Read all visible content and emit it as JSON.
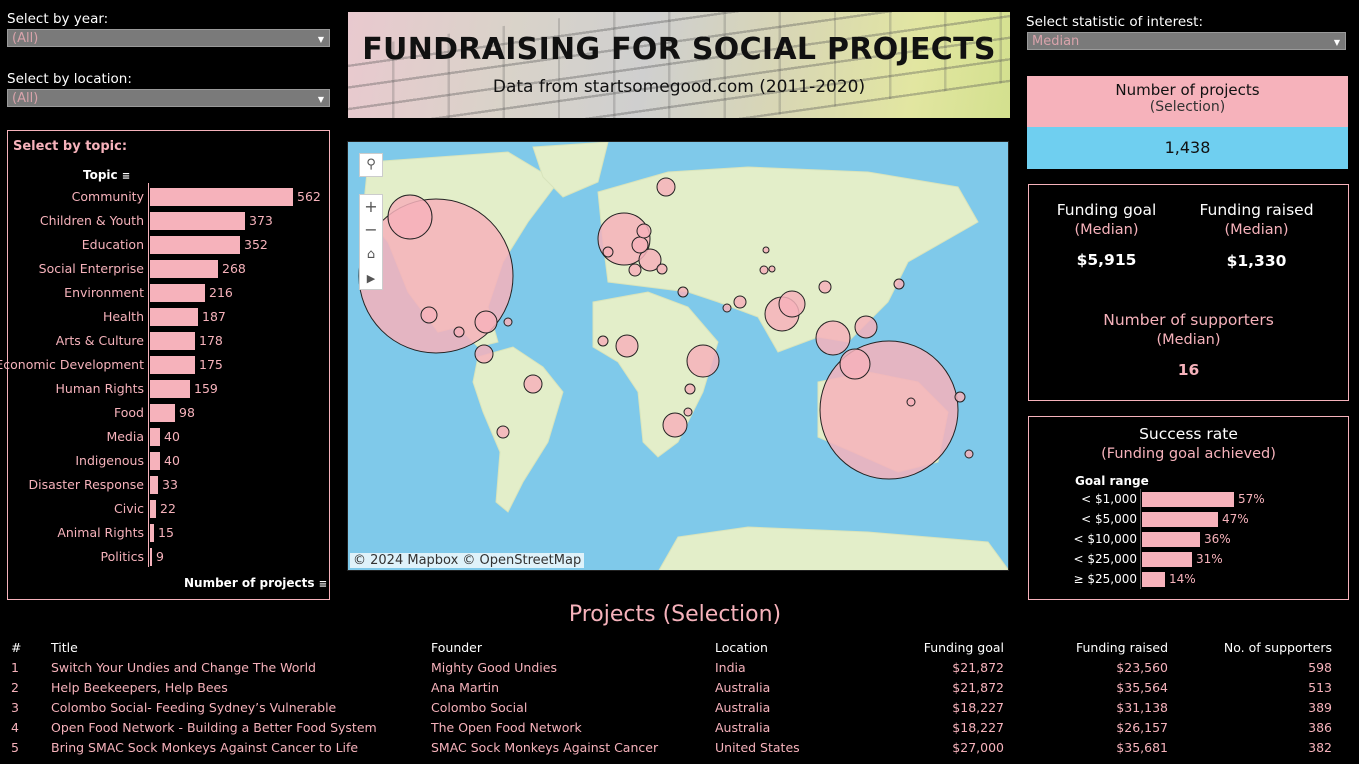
{
  "filters": {
    "year_label": "Select by year:",
    "year_value": "(All)",
    "location_label": "Select by location:",
    "location_value": "(All)",
    "statistic_label": "Select statistic of interest:",
    "statistic_value": "Median"
  },
  "banner": {
    "title": "FUNDRAISING FOR SOCIAL PROJECTS",
    "subtitle": "Data from startsomegood.com (2011-2020)"
  },
  "topic_panel": {
    "title": "Select by topic:",
    "header": "Topic",
    "axis_label": "Number of projects"
  },
  "chart_data": [
    {
      "type": "bar",
      "orientation": "horizontal",
      "categories": [
        "Community",
        "Children & Youth",
        "Education",
        "Social Enterprise",
        "Environment",
        "Health",
        "Arts & Culture",
        "Economic Development",
        "Human Rights",
        "Food",
        "Media",
        "Indigenous",
        "Disaster Response",
        "Civic",
        "Animal Rights",
        "Politics"
      ],
      "values": [
        562,
        373,
        352,
        268,
        216,
        187,
        178,
        175,
        159,
        98,
        40,
        40,
        33,
        22,
        15,
        9
      ],
      "xlabel": "Number of projects",
      "ylabel": "Topic",
      "color": "#f6b2bb"
    },
    {
      "type": "bar",
      "orientation": "horizontal",
      "categories": [
        "< $1,000",
        "< $5,000",
        "< $10,000",
        "< $25,000",
        "≥ $25,000"
      ],
      "values": [
        57,
        47,
        36,
        31,
        14
      ],
      "value_labels": [
        "57%",
        "47%",
        "36%",
        "31%",
        "14%"
      ],
      "ylabel": "Goal range",
      "color": "#f6b2bb"
    }
  ],
  "stats": {
    "num_projects_title": "Number of projects",
    "num_projects_sub": "(Selection)",
    "num_projects_value": "1,438",
    "funding_goal_title": "Funding goal",
    "funding_goal_sub": "(Median)",
    "funding_goal_value": "$5,915",
    "funding_raised_title": "Funding raised",
    "funding_raised_sub": "(Median)",
    "funding_raised_value": "$1,330",
    "supporters_title": "Number of supporters",
    "supporters_sub": "(Median)",
    "supporters_value": "16",
    "success_title": "Success rate",
    "success_sub": "(Funding goal achieved)",
    "success_axis": "Goal range"
  },
  "map": {
    "attribution": "© 2024 Mapbox  © OpenStreetMap",
    "icons": [
      "search-icon",
      "zoom-in-icon",
      "zoom-out-icon",
      "home-icon",
      "play-icon"
    ]
  },
  "table": {
    "title": "Projects (Selection)",
    "headers": [
      "#",
      "Title",
      "Founder",
      "Location",
      "Funding goal",
      "Funding raised",
      "No. of supporters"
    ],
    "rows": [
      [
        "1",
        "Switch Your Undies and Change The World",
        "Mighty Good Undies",
        "India",
        "$21,872",
        "$23,560",
        "598"
      ],
      [
        "2",
        "Help Beekeepers, Help Bees",
        "Ana Martin",
        "Australia",
        "$21,872",
        "$35,564",
        "513"
      ],
      [
        "3",
        "Colombo Social- Feeding Sydney’s Vulnerable",
        "Colombo Social",
        "Australia",
        "$18,227",
        "$31,138",
        "389"
      ],
      [
        "4",
        "Open Food Network - Building a Better Food System",
        "The Open Food Network",
        "Australia",
        "$18,227",
        "$26,157",
        "386"
      ],
      [
        "5",
        "Bring SMAC Sock Monkeys Against Cancer to Life",
        "SMAC Sock Monkeys Against Cancer",
        "United States",
        "$27,000",
        "$35,681",
        "382"
      ]
    ]
  },
  "colors": {
    "accent": "#f6b2bb",
    "stat_blue": "#6fcff0",
    "background": "#000000",
    "ocean": "#7fc9ea",
    "land": "#e3eec9"
  }
}
